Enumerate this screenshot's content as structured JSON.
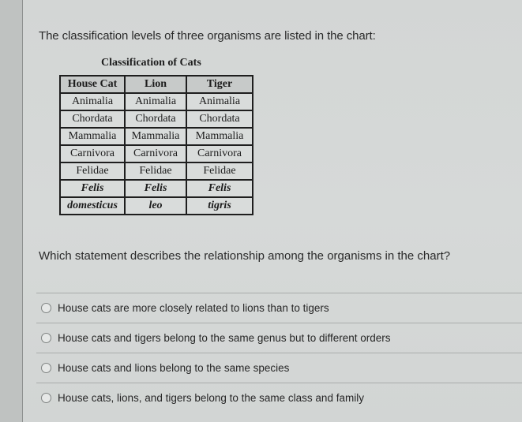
{
  "intro_text": "The classification levels of three organisms are listed in the chart:",
  "table": {
    "title": "Classification of Cats",
    "headers": [
      "House Cat",
      "Lion",
      "Tiger"
    ],
    "rows": [
      [
        "Animalia",
        "Animalia",
        "Animalia"
      ],
      [
        "Chordata",
        "Chordata",
        "Chordata"
      ],
      [
        "Mammalia",
        "Mammalia",
        "Mammalia"
      ],
      [
        "Carnivora",
        "Carnivora",
        "Carnivora"
      ],
      [
        "Felidae",
        "Felidae",
        "Felidae"
      ],
      [
        "Felis",
        "Felis",
        "Felis"
      ],
      [
        "domesticus",
        "leo",
        "tigris"
      ]
    ]
  },
  "question": "Which statement describes the relationship among the organisms in the chart?",
  "options": [
    {
      "label": "House cats are more closely related to lions than to tigers",
      "selected": false
    },
    {
      "label": "House cats and tigers belong to the same genus but to different orders",
      "selected": false
    },
    {
      "label": "House cats and lions belong to the same species",
      "selected": false
    },
    {
      "label": "House cats, lions, and tigers belong to the same class and family",
      "selected": false
    }
  ]
}
